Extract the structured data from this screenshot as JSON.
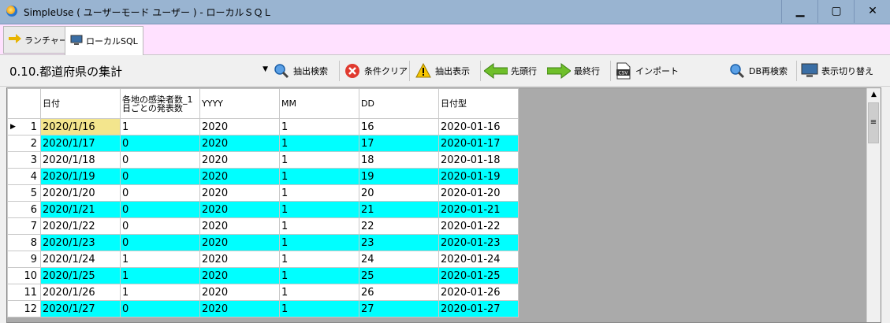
{
  "window": {
    "title": "SimpleUse ( ユーザーモード ユーザー ) - ローカルＳＱＬ",
    "minimize": "▁",
    "maximize": "▢",
    "close": "✕"
  },
  "tabs": [
    {
      "label": "ランチャー"
    },
    {
      "label": "ローカルSQL"
    }
  ],
  "toolbar": {
    "query_select": "0.10.都道府県の集計",
    "extract_search": "抽出検索",
    "clear_conditions": "条件クリア",
    "extract_display": "抽出表示",
    "first_row": "先頭行",
    "last_row": "最終行",
    "import": "インポート",
    "db_research": "DB再検索",
    "toggle_display": "表示切り替え",
    "csv_badge": "CSV"
  },
  "grid": {
    "columns": [
      "日付",
      "各地の感染者数_1日ごとの発表数",
      "YYYY",
      "MM",
      "DD",
      "日付型"
    ],
    "rows": [
      [
        "1",
        "2020/1/16",
        "1",
        "2020",
        "1",
        "16",
        "2020-01-16"
      ],
      [
        "2",
        "2020/1/17",
        "0",
        "2020",
        "1",
        "17",
        "2020-01-17"
      ],
      [
        "3",
        "2020/1/18",
        "0",
        "2020",
        "1",
        "18",
        "2020-01-18"
      ],
      [
        "4",
        "2020/1/19",
        "0",
        "2020",
        "1",
        "19",
        "2020-01-19"
      ],
      [
        "5",
        "2020/1/20",
        "0",
        "2020",
        "1",
        "20",
        "2020-01-20"
      ],
      [
        "6",
        "2020/1/21",
        "0",
        "2020",
        "1",
        "21",
        "2020-01-21"
      ],
      [
        "7",
        "2020/1/22",
        "0",
        "2020",
        "1",
        "22",
        "2020-01-22"
      ],
      [
        "8",
        "2020/1/23",
        "0",
        "2020",
        "1",
        "23",
        "2020-01-23"
      ],
      [
        "9",
        "2020/1/24",
        "1",
        "2020",
        "1",
        "24",
        "2020-01-24"
      ],
      [
        "10",
        "2020/1/25",
        "1",
        "2020",
        "1",
        "25",
        "2020-01-25"
      ],
      [
        "11",
        "2020/1/26",
        "1",
        "2020",
        "1",
        "26",
        "2020-01-26"
      ],
      [
        "12",
        "2020/1/27",
        "0",
        "2020",
        "1",
        "27",
        "2020-01-27"
      ]
    ]
  },
  "colors": {
    "alt_row": "#00ffff",
    "selected_cell": "#f3e58d",
    "tab_strip": "#ffe1ff"
  }
}
